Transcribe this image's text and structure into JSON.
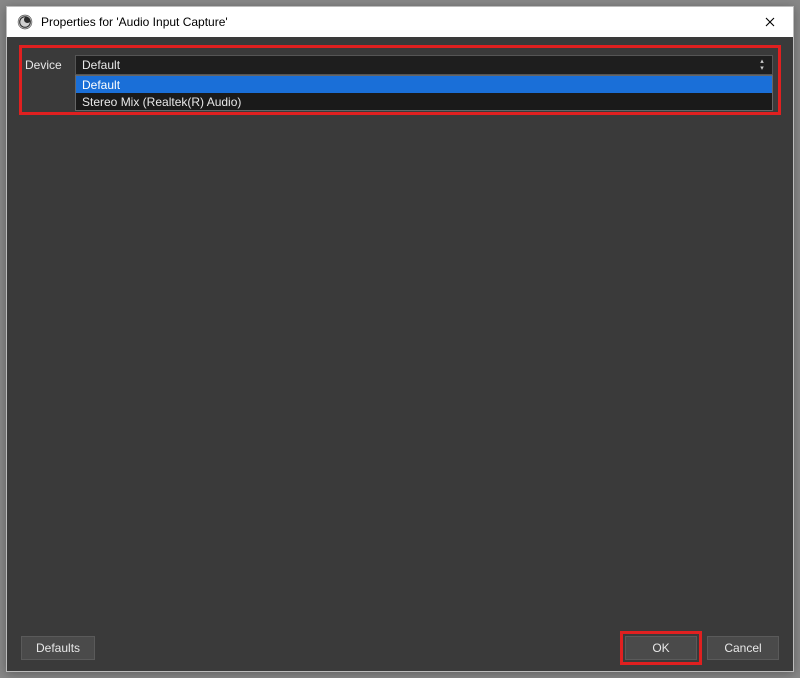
{
  "titlebar": {
    "title": "Properties for 'Audio Input Capture'"
  },
  "device": {
    "label": "Device",
    "selected": "Default",
    "options": [
      "Default",
      "Stereo Mix (Realtek(R) Audio)"
    ]
  },
  "footer": {
    "defaults": "Defaults",
    "ok": "OK",
    "cancel": "Cancel"
  }
}
